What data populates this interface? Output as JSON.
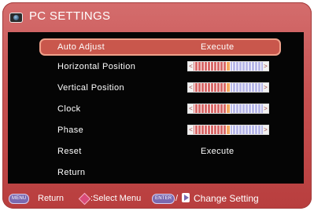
{
  "title": "PC SETTINGS",
  "menu": [
    {
      "label": "Auto Adjust",
      "value": "Execute",
      "selected": true
    },
    {
      "label": "Horizontal Position",
      "slider_percent": 50
    },
    {
      "label": "Vertical Position",
      "slider_percent": 50
    },
    {
      "label": "Clock",
      "slider_percent": 50
    },
    {
      "label": "Phase",
      "slider_percent": 50
    },
    {
      "label": "Reset",
      "value": "Execute"
    },
    {
      "label": "Return"
    }
  ],
  "slider_left_cap": "<",
  "slider_right_cap": ">",
  "footer": {
    "menu_key": "MENU",
    "return_text": "Return",
    "select_text": ":Select Menu",
    "enter_key": "ENTER",
    "slash": "/",
    "change_text": "Change Setting"
  },
  "colors": {
    "frame": "#c75151",
    "panel": "#050505",
    "selection": "#c9574c",
    "slider_thumb": "#f4a85f"
  },
  "icons": {
    "title": "monitor-icon",
    "select": "up-down-diamond-icon",
    "change": "right-arrow-icon"
  }
}
